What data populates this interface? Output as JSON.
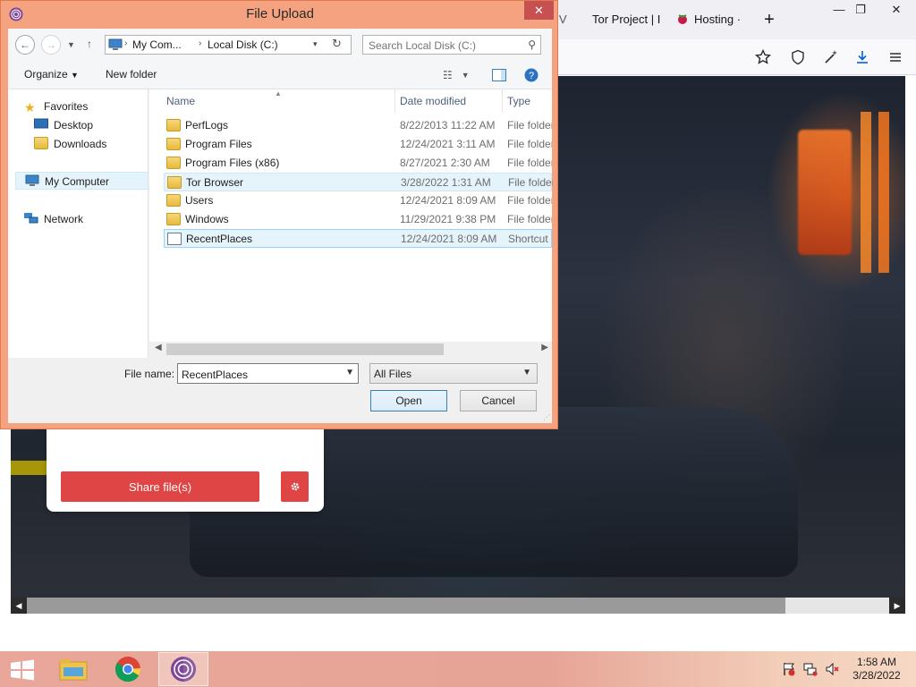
{
  "browser": {
    "tabs": [
      {
        "label": "n V",
        "partial": true
      },
      {
        "label": "Tor Project | I",
        "icon": "tor-project-favicon"
      },
      {
        "label": "Hosting ·",
        "icon": "raspberry-pi-icon"
      }
    ],
    "window_controls": {
      "minimize": "—",
      "restore": "❐",
      "close": "✕"
    },
    "toolbar_icons": [
      "star-icon",
      "shield-icon",
      "magic-wand-icon",
      "download-icon",
      "menu-icon"
    ],
    "page": {
      "share_button_label": "Share file(s)",
      "settings_icon": "gear-icon"
    }
  },
  "dialog": {
    "title": "File Upload",
    "address": {
      "crumbs": [
        "My Com...",
        "Local Disk (C:)"
      ]
    },
    "search_placeholder": "Search Local Disk (C:)",
    "toolbar": {
      "organize": "Organize",
      "new_folder": "New folder"
    },
    "nav": {
      "favorites": "Favorites",
      "desktop": "Desktop",
      "downloads": "Downloads",
      "my_computer": "My Computer",
      "network": "Network"
    },
    "columns": {
      "name": "Name",
      "date": "Date modified",
      "type": "Type"
    },
    "files": [
      {
        "name": "PerfLogs",
        "date": "8/22/2013 11:22 AM",
        "type": "File folder",
        "kind": "folder"
      },
      {
        "name": "Program Files",
        "date": "12/24/2021 3:11 AM",
        "type": "File folder",
        "kind": "folder"
      },
      {
        "name": "Program Files (x86)",
        "date": "8/27/2021 2:30 AM",
        "type": "File folder",
        "kind": "folder"
      },
      {
        "name": "Tor Browser",
        "date": "3/28/2022 1:31 AM",
        "type": "File folder",
        "kind": "folder"
      },
      {
        "name": "Users",
        "date": "12/24/2021 8:09 AM",
        "type": "File folder",
        "kind": "folder"
      },
      {
        "name": "Windows",
        "date": "11/29/2021 9:38 PM",
        "type": "File folder",
        "kind": "folder"
      },
      {
        "name": "RecentPlaces",
        "date": "12/24/2021 8:09 AM",
        "type": "Shortcut",
        "kind": "shortcut"
      }
    ],
    "file_name_label": "File name:",
    "file_name_value": "RecentPlaces",
    "file_type": "All Files",
    "open_label": "Open",
    "cancel_label": "Cancel",
    "close_label": "✕"
  },
  "taskbar": {
    "apps": [
      "file-explorer-icon",
      "chrome-icon",
      "tor-browser-icon"
    ],
    "time": "1:58 AM",
    "date": "3/28/2022"
  }
}
